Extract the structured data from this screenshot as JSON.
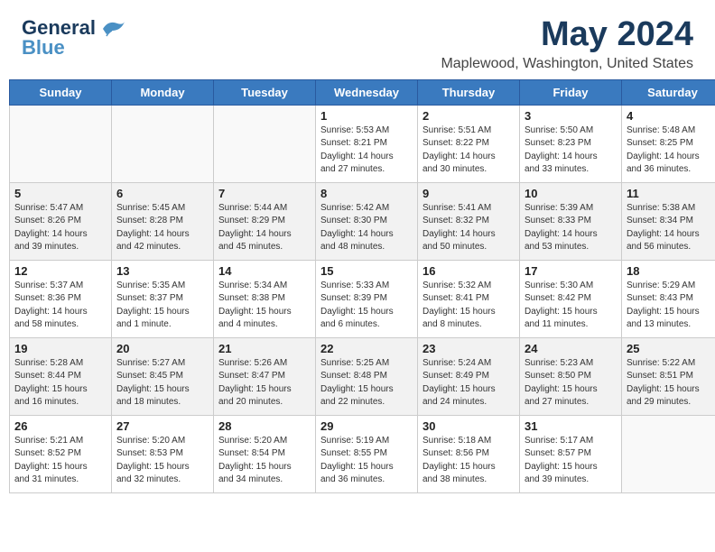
{
  "header": {
    "logo_general": "General",
    "logo_blue": "Blue",
    "month_title": "May 2024",
    "location": "Maplewood, Washington, United States"
  },
  "weekdays": [
    "Sunday",
    "Monday",
    "Tuesday",
    "Wednesday",
    "Thursday",
    "Friday",
    "Saturday"
  ],
  "weeks": [
    [
      {
        "day": "",
        "info": ""
      },
      {
        "day": "",
        "info": ""
      },
      {
        "day": "",
        "info": ""
      },
      {
        "day": "1",
        "info": "Sunrise: 5:53 AM\nSunset: 8:21 PM\nDaylight: 14 hours\nand 27 minutes."
      },
      {
        "day": "2",
        "info": "Sunrise: 5:51 AM\nSunset: 8:22 PM\nDaylight: 14 hours\nand 30 minutes."
      },
      {
        "day": "3",
        "info": "Sunrise: 5:50 AM\nSunset: 8:23 PM\nDaylight: 14 hours\nand 33 minutes."
      },
      {
        "day": "4",
        "info": "Sunrise: 5:48 AM\nSunset: 8:25 PM\nDaylight: 14 hours\nand 36 minutes."
      }
    ],
    [
      {
        "day": "5",
        "info": "Sunrise: 5:47 AM\nSunset: 8:26 PM\nDaylight: 14 hours\nand 39 minutes."
      },
      {
        "day": "6",
        "info": "Sunrise: 5:45 AM\nSunset: 8:28 PM\nDaylight: 14 hours\nand 42 minutes."
      },
      {
        "day": "7",
        "info": "Sunrise: 5:44 AM\nSunset: 8:29 PM\nDaylight: 14 hours\nand 45 minutes."
      },
      {
        "day": "8",
        "info": "Sunrise: 5:42 AM\nSunset: 8:30 PM\nDaylight: 14 hours\nand 48 minutes."
      },
      {
        "day": "9",
        "info": "Sunrise: 5:41 AM\nSunset: 8:32 PM\nDaylight: 14 hours\nand 50 minutes."
      },
      {
        "day": "10",
        "info": "Sunrise: 5:39 AM\nSunset: 8:33 PM\nDaylight: 14 hours\nand 53 minutes."
      },
      {
        "day": "11",
        "info": "Sunrise: 5:38 AM\nSunset: 8:34 PM\nDaylight: 14 hours\nand 56 minutes."
      }
    ],
    [
      {
        "day": "12",
        "info": "Sunrise: 5:37 AM\nSunset: 8:36 PM\nDaylight: 14 hours\nand 58 minutes."
      },
      {
        "day": "13",
        "info": "Sunrise: 5:35 AM\nSunset: 8:37 PM\nDaylight: 15 hours\nand 1 minute."
      },
      {
        "day": "14",
        "info": "Sunrise: 5:34 AM\nSunset: 8:38 PM\nDaylight: 15 hours\nand 4 minutes."
      },
      {
        "day": "15",
        "info": "Sunrise: 5:33 AM\nSunset: 8:39 PM\nDaylight: 15 hours\nand 6 minutes."
      },
      {
        "day": "16",
        "info": "Sunrise: 5:32 AM\nSunset: 8:41 PM\nDaylight: 15 hours\nand 8 minutes."
      },
      {
        "day": "17",
        "info": "Sunrise: 5:30 AM\nSunset: 8:42 PM\nDaylight: 15 hours\nand 11 minutes."
      },
      {
        "day": "18",
        "info": "Sunrise: 5:29 AM\nSunset: 8:43 PM\nDaylight: 15 hours\nand 13 minutes."
      }
    ],
    [
      {
        "day": "19",
        "info": "Sunrise: 5:28 AM\nSunset: 8:44 PM\nDaylight: 15 hours\nand 16 minutes."
      },
      {
        "day": "20",
        "info": "Sunrise: 5:27 AM\nSunset: 8:45 PM\nDaylight: 15 hours\nand 18 minutes."
      },
      {
        "day": "21",
        "info": "Sunrise: 5:26 AM\nSunset: 8:47 PM\nDaylight: 15 hours\nand 20 minutes."
      },
      {
        "day": "22",
        "info": "Sunrise: 5:25 AM\nSunset: 8:48 PM\nDaylight: 15 hours\nand 22 minutes."
      },
      {
        "day": "23",
        "info": "Sunrise: 5:24 AM\nSunset: 8:49 PM\nDaylight: 15 hours\nand 24 minutes."
      },
      {
        "day": "24",
        "info": "Sunrise: 5:23 AM\nSunset: 8:50 PM\nDaylight: 15 hours\nand 27 minutes."
      },
      {
        "day": "25",
        "info": "Sunrise: 5:22 AM\nSunset: 8:51 PM\nDaylight: 15 hours\nand 29 minutes."
      }
    ],
    [
      {
        "day": "26",
        "info": "Sunrise: 5:21 AM\nSunset: 8:52 PM\nDaylight: 15 hours\nand 31 minutes."
      },
      {
        "day": "27",
        "info": "Sunrise: 5:20 AM\nSunset: 8:53 PM\nDaylight: 15 hours\nand 32 minutes."
      },
      {
        "day": "28",
        "info": "Sunrise: 5:20 AM\nSunset: 8:54 PM\nDaylight: 15 hours\nand 34 minutes."
      },
      {
        "day": "29",
        "info": "Sunrise: 5:19 AM\nSunset: 8:55 PM\nDaylight: 15 hours\nand 36 minutes."
      },
      {
        "day": "30",
        "info": "Sunrise: 5:18 AM\nSunset: 8:56 PM\nDaylight: 15 hours\nand 38 minutes."
      },
      {
        "day": "31",
        "info": "Sunrise: 5:17 AM\nSunset: 8:57 PM\nDaylight: 15 hours\nand 39 minutes."
      },
      {
        "day": "",
        "info": ""
      }
    ]
  ]
}
